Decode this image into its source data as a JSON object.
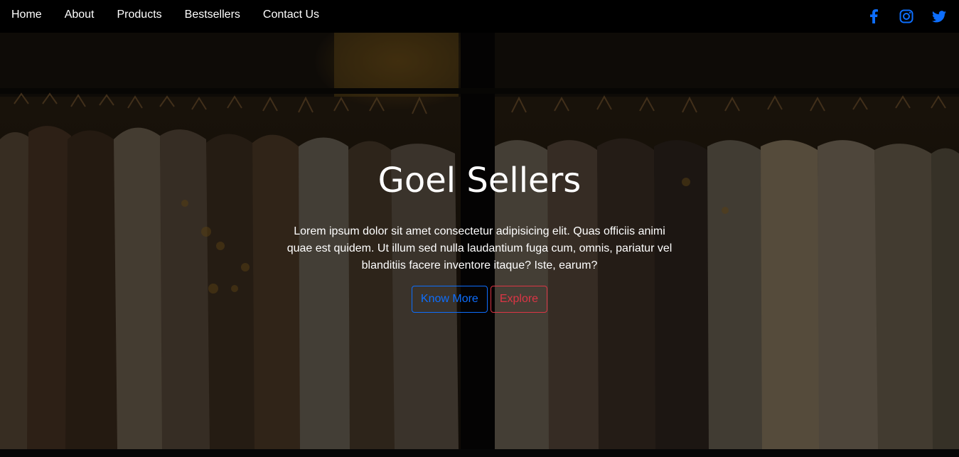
{
  "nav": {
    "links": [
      "Home",
      "About",
      "Products",
      "Bestsellers",
      "Contact Us"
    ],
    "social": [
      {
        "icon": "facebook-icon",
        "color": "#0d6efd"
      },
      {
        "icon": "instagram-icon",
        "color": "#0d6efd"
      },
      {
        "icon": "twitter-icon",
        "color": "#0d6efd"
      }
    ]
  },
  "hero": {
    "title": "Goel Sellers",
    "text": "Lorem ipsum dolor sit amet consectetur adipisicing elit. Quas officiis animi quae est quidem. Ut illum sed nulla laudantium fuga cum, omnis, pariatur vel blanditiis facere inventore itaque? Iste, earum?",
    "buttons": {
      "know_more": "Know More",
      "explore": "Explore"
    },
    "background_icon": "clothing-rack-photo"
  },
  "colors": {
    "primary": "#0d6efd",
    "danger": "#dc3545",
    "nav_bg": "#000000"
  }
}
